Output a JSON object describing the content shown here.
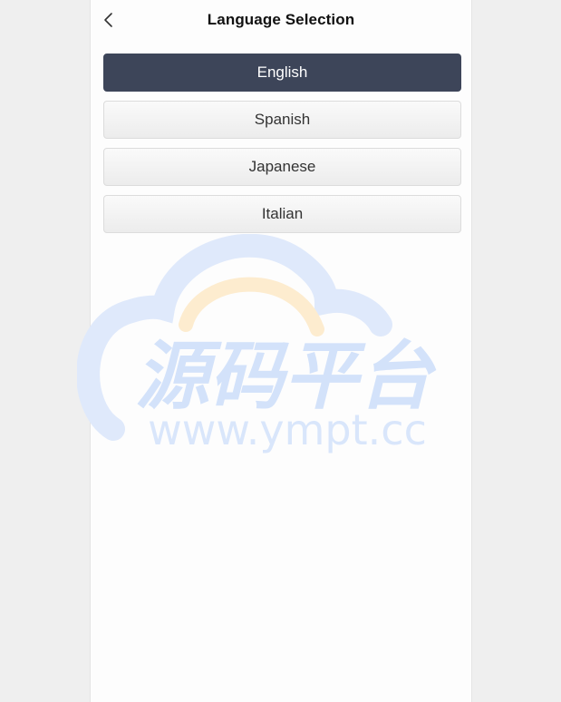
{
  "header": {
    "title": "Language Selection",
    "back_icon": "chevron-left-icon"
  },
  "languages": [
    {
      "label": "English",
      "selected": true
    },
    {
      "label": "Spanish",
      "selected": false
    },
    {
      "label": "Japanese",
      "selected": false
    },
    {
      "label": "Italian",
      "selected": false
    }
  ],
  "watermark": {
    "chinese_text": "源码平台",
    "url_text": "www.ympt.cc",
    "cloud_color": "#dfe9fb",
    "arc_color": "#fdeccf",
    "text_color": "#d3e2fa"
  },
  "colors": {
    "selected_bg": "#3d4559",
    "button_bg": "#f2f2f2",
    "page_bg": "#efefef"
  }
}
